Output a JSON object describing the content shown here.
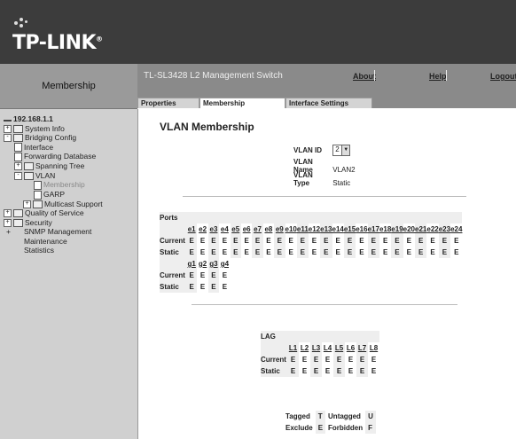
{
  "brand": {
    "name": "TP-LINK",
    "mark": "®"
  },
  "nav_header": {
    "title": "Membership"
  },
  "header": {
    "switch_name": "TL-SL3428 L2 Management Switch",
    "links": {
      "about": "About",
      "help": "Help",
      "logout": "Logout"
    }
  },
  "tabs": [
    "Properties",
    "Membership",
    "Interface Settings"
  ],
  "active_tab": "Membership",
  "tree": {
    "root": "192.168.1.1",
    "system_info": "System Info",
    "bridging_config": "Bridging Config",
    "interface": "Interface",
    "forwarding_database": "Forwarding Database",
    "spanning_tree": "Spanning Tree",
    "vlan": "VLAN",
    "membership": "Membership",
    "garp": "GARP",
    "multicast_support": "Multicast Support",
    "quality_of_service": "Quality of Service",
    "security": "Security",
    "snmp_management": "SNMP Management",
    "maintenance": "Maintenance",
    "statistics": "Statistics"
  },
  "page_title": "VLAN Membership",
  "vlan": {
    "id_label": "VLAN ID",
    "id_value": "2",
    "name_label": "VLAN Name",
    "name_value": "VLAN2",
    "type_label": "VLAN Type",
    "type_value": "Static"
  },
  "ports": {
    "title": "Ports",
    "row_labels": {
      "current": "Current",
      "static": "Static"
    },
    "eth": [
      "e1",
      "e2",
      "e3",
      "e4",
      "e5",
      "e6",
      "e7",
      "e8",
      "e9",
      "e10",
      "e11",
      "e12",
      "e13",
      "e14",
      "e15",
      "e16",
      "e17",
      "e18",
      "e19",
      "e20",
      "e21",
      "e22",
      "e23",
      "e24"
    ],
    "eth_current": [
      "E",
      "E",
      "E",
      "E",
      "E",
      "E",
      "E",
      "E",
      "E",
      "E",
      "E",
      "E",
      "E",
      "E",
      "E",
      "E",
      "E",
      "E",
      "E",
      "E",
      "E",
      "E",
      "E",
      "E"
    ],
    "eth_static": [
      "E",
      "E",
      "E",
      "E",
      "E",
      "E",
      "E",
      "E",
      "E",
      "E",
      "E",
      "E",
      "E",
      "E",
      "E",
      "E",
      "E",
      "E",
      "E",
      "E",
      "E",
      "E",
      "E",
      "E"
    ],
    "gig": [
      "g1",
      "g2",
      "g3",
      "g4"
    ],
    "gig_current": [
      "E",
      "E",
      "E",
      "E"
    ],
    "gig_static": [
      "E",
      "E",
      "E",
      "E"
    ]
  },
  "lag": {
    "title": "LAG",
    "ports": [
      "L1",
      "L2",
      "L3",
      "L4",
      "L5",
      "L6",
      "L7",
      "L8"
    ],
    "current": [
      "E",
      "E",
      "E",
      "E",
      "E",
      "E",
      "E",
      "E"
    ],
    "static": [
      "E",
      "E",
      "E",
      "E",
      "E",
      "E",
      "E",
      "E"
    ]
  },
  "legend": {
    "tagged": "Tagged",
    "tagged_key": "T",
    "untagged": "Untagged",
    "untagged_key": "U",
    "exclude": "Exclude",
    "exclude_key": "E",
    "forbidden": "Forbidden",
    "forbidden_key": "F"
  }
}
